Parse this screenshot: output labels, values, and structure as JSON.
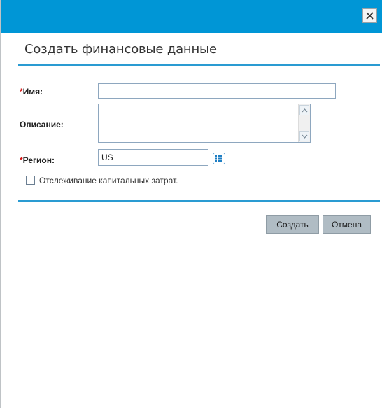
{
  "dialog": {
    "title": "Создать финансовые данные",
    "close_icon": "close-icon"
  },
  "form": {
    "name": {
      "required_mark": "*",
      "label": "Имя:",
      "value": ""
    },
    "description": {
      "label": "Описание:",
      "value": ""
    },
    "region": {
      "required_mark": "*",
      "label": "Регион:",
      "value": "US",
      "picker_icon": "list-icon"
    },
    "capital_tracking": {
      "label": "Отслеживание капитальных затрат.",
      "checked": false
    }
  },
  "buttons": {
    "create": "Создать",
    "cancel": "Отмена"
  },
  "colors": {
    "header": "#0096d6",
    "rule": "#2a9bd2",
    "required": "#d01010",
    "button": "#b0bcc4"
  }
}
